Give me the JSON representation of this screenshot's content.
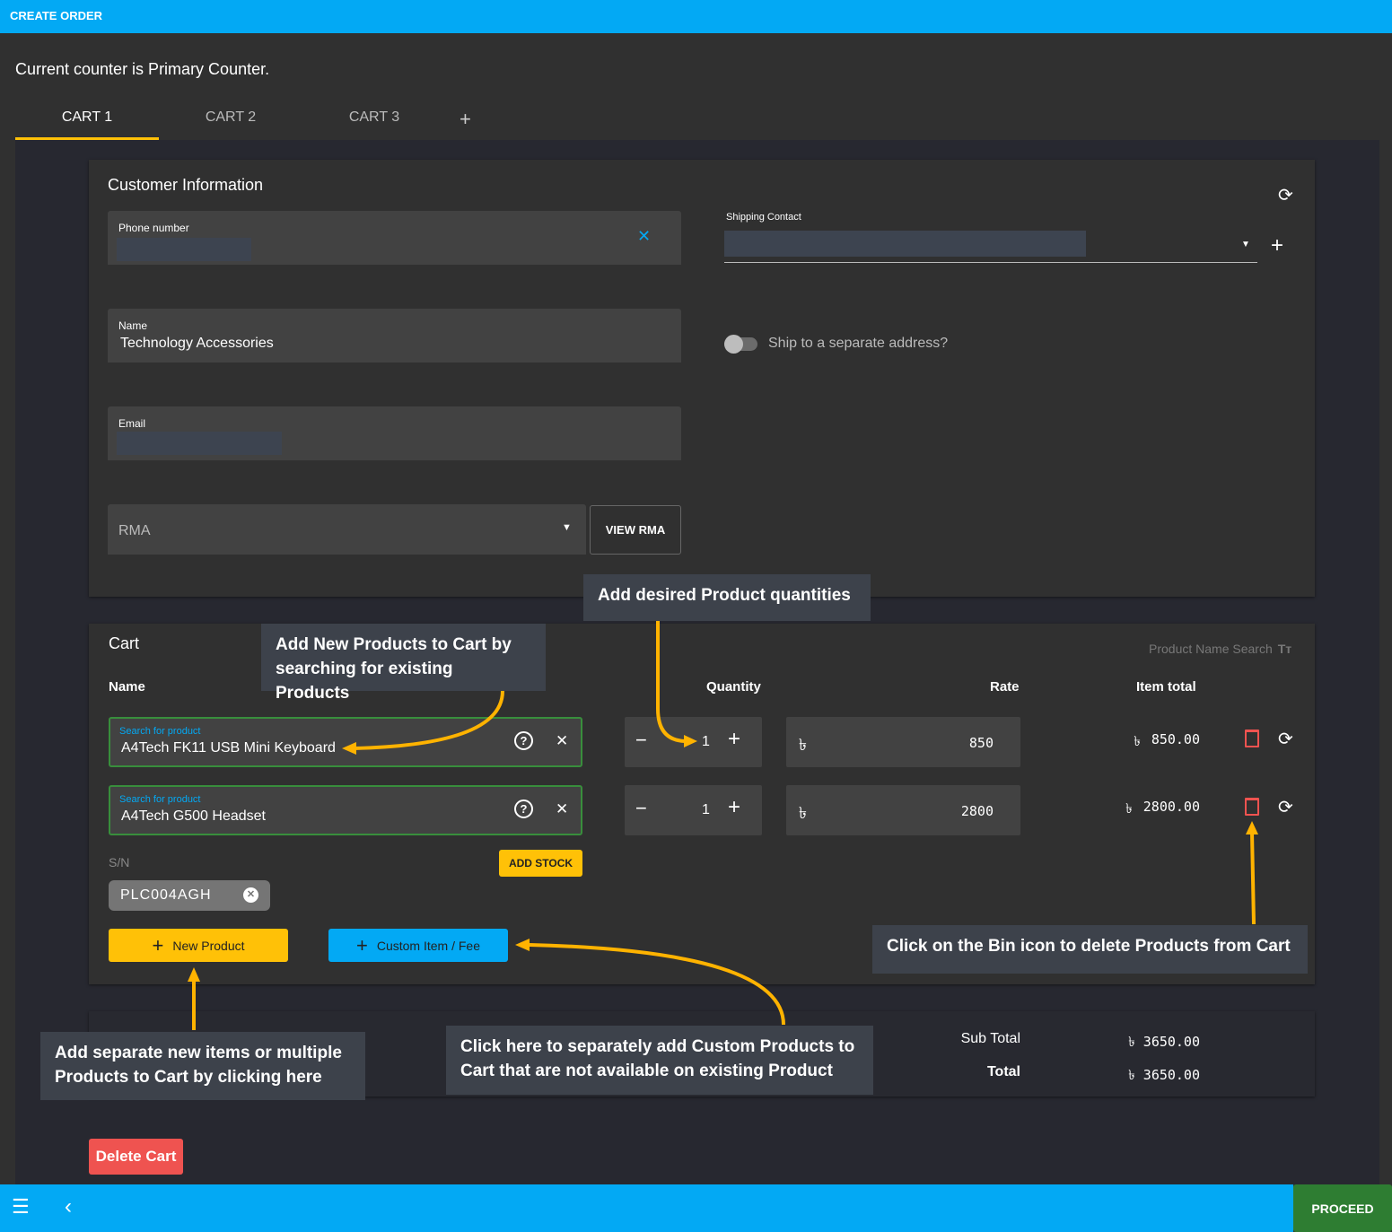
{
  "header": {
    "title": "CREATE ORDER"
  },
  "counter_text": "Current counter is Primary Counter.",
  "tabs": [
    {
      "label": "CART 1",
      "active": true
    },
    {
      "label": "CART 2"
    },
    {
      "label": "CART 3"
    }
  ],
  "add_tab_icon": "plus-icon",
  "customer": {
    "title": "Customer Information",
    "phone_label": "Phone number",
    "name_label": "Name",
    "name_value": "Technology Accessories",
    "email_label": "Email",
    "rma_placeholder": "RMA",
    "view_rma": "VIEW RMA",
    "shipping_label": "Shipping Contact",
    "ship_toggle_label": "Ship to a separate address?",
    "ship_toggle_on": false
  },
  "cart": {
    "title": "Cart",
    "search_mode": "Product Name Search",
    "columns": {
      "name": "Name",
      "quantity": "Quantity",
      "rate": "Rate",
      "item_total": "Item total"
    },
    "currency": "৳",
    "items": [
      {
        "label": "Search for product",
        "name": "A4Tech FK11 USB Mini Keyboard",
        "qty": "1",
        "rate": "850",
        "total": "850.00"
      },
      {
        "label": "Search for product",
        "name": "A4Tech G500 Headset",
        "qty": "1",
        "rate": "2800",
        "total": "2800.00"
      }
    ],
    "sn_label": "S/N",
    "sn_chip": "PLC004AGH",
    "add_stock": "ADD STOCK",
    "new_product": "New Product",
    "custom_item": "Custom Item / Fee"
  },
  "totals": {
    "sub_total_label": "Sub Total",
    "sub_total": "৳ 3650.00",
    "total_label": "Total",
    "total": "৳ 3650.00"
  },
  "delete_cart": "Delete Cart",
  "footer": {
    "proceed": "PROCEED"
  },
  "callouts": {
    "quantities": "Add desired Product quantities",
    "search": "Add New Products to Cart by searching for existing Products",
    "bin": "Click on the Bin icon to delete Products from Cart",
    "new_items": "Add separate new items or multiple Products to Cart by clicking here",
    "custom": "Click here to separately add Custom Products to Cart that are not available on existing Product"
  },
  "colors": {
    "primary": "#03a9f4",
    "accent": "#ffc107",
    "danger": "#ef5350",
    "success": "#2e7d32",
    "callout_arrow": "#ffb300"
  }
}
